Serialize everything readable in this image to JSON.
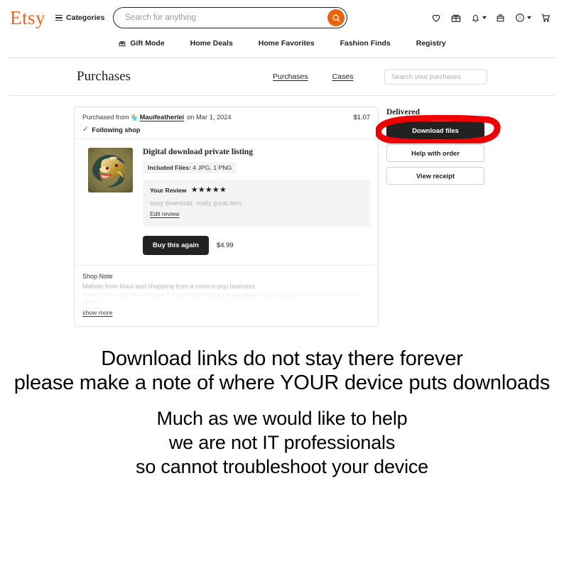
{
  "header": {
    "logo": "Etsy",
    "categories_label": "Categories",
    "search_placeholder": "Search for anything",
    "search_value": "",
    "icons": [
      {
        "name": "favorites-icon",
        "label": "heart-icon"
      },
      {
        "name": "gifts-icon",
        "label": "gift-icon"
      },
      {
        "name": "notifications-icon",
        "label": "bell-icon"
      },
      {
        "name": "shop-manager-icon",
        "label": "mailbox-icon"
      },
      {
        "name": "account-icon",
        "label": "account-circle-icon"
      },
      {
        "name": "cart-icon",
        "label": "shopping-cart-icon"
      }
    ],
    "nav": [
      {
        "label": "Gift Mode",
        "icon": "gift-icon"
      },
      {
        "label": "Home Deals",
        "icon": ""
      },
      {
        "label": "Home Favorites",
        "icon": ""
      },
      {
        "label": "Fashion Finds",
        "icon": ""
      },
      {
        "label": "Registry",
        "icon": ""
      }
    ]
  },
  "purchases_bar": {
    "title": "Purchases",
    "tabs": [
      {
        "label": "Purchases",
        "active": true
      },
      {
        "label": "Cases",
        "active": false
      }
    ],
    "search_placeholder": "Search your purchases",
    "search_value": ""
  },
  "order": {
    "purchased_from_prefix": "Purchased from",
    "shop_name": "Mauifeatherlei",
    "date_text": "on Mar 1, 2024",
    "total": "$1.07",
    "following_shop": "Following shop",
    "listing_title": "Digital download private listing",
    "included_files_label": "Included Files:",
    "included_files_value": "4 JPG, 1 PNG",
    "review": {
      "label": "Your Review",
      "stars": "★★★★★",
      "rating": 5,
      "text": "easy download, really great item",
      "edit_link": "Edit review"
    },
    "buy_again_label": "Buy this again",
    "buy_again_price": "$4.99",
    "shop_note": {
      "title": "Shop Note",
      "line1": "Mahalo from Maui and shopping from a mom-n-pop business.",
      "line2": "Please leave positive feedback if you have had a pleasurable shopping experience and I have met your",
      "show_more": "show more"
    }
  },
  "order_side": {
    "status": "Delivered",
    "buttons": [
      {
        "label": "Download files",
        "style": "dark",
        "name": "download-files-button"
      },
      {
        "label": "Help with order",
        "style": "light",
        "name": "help-with-order-button"
      },
      {
        "label": "View receipt",
        "style": "light",
        "name": "view-receipt-button"
      }
    ],
    "annotation_color": "#F00000"
  },
  "bottom_message": {
    "group1": [
      "Download links do not stay there forever",
      "please make a note of where YOUR device puts downloads"
    ],
    "group2": [
      "Much as we would like to help",
      "we are not IT professionals",
      "so cannot troubleshoot your device"
    ]
  },
  "colors": {
    "brand_orange": "#E8640C",
    "logo_orange": "#F1641E",
    "dark_button": "#222222",
    "annotation_red": "#F00000"
  }
}
